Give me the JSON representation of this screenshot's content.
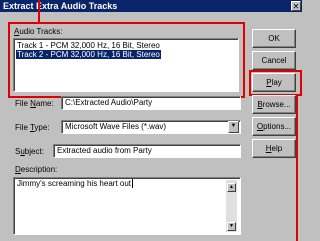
{
  "window": {
    "title": "Extract Extra Audio Tracks",
    "close_glyph": "✕"
  },
  "audio_tracks": {
    "label_prefix": "",
    "label_underlined": "A",
    "label_rest": "udio Tracks:",
    "items": [
      {
        "label": "Track 1 - PCM 32,000 Hz, 16 Bit, Stereo",
        "selected": false
      },
      {
        "label": "Track 2 - PCM 32,000 Hz, 16 Bit, Stereo",
        "selected": true
      }
    ]
  },
  "buttons": {
    "ok": "OK",
    "cancel": "Cancel",
    "play": {
      "u": "P",
      "rest": "lay"
    },
    "browse": {
      "u": "B",
      "rest": "rowse..."
    },
    "options": {
      "u": "O",
      "rest": "ptions..."
    },
    "help": {
      "u": "H",
      "rest": "elp"
    }
  },
  "file_name": {
    "label_a": "File ",
    "label_u": "N",
    "label_b": "ame:",
    "value": "C:\\Extracted Audio\\Party"
  },
  "file_type": {
    "label_a": "File ",
    "label_u": "T",
    "label_b": "ype:",
    "value": "Microsoft Wave Files (*.wav)"
  },
  "subject": {
    "label_a": "S",
    "label_u": "u",
    "label_b": "bject:",
    "value": "Extracted audio from Party"
  },
  "description": {
    "label_u": "D",
    "label_b": "escription:",
    "value": "Jimmy's screaming his heart out"
  },
  "colors": {
    "annotation": "#e00000",
    "selection": "#0a246a",
    "face": "#c0c0c0"
  }
}
